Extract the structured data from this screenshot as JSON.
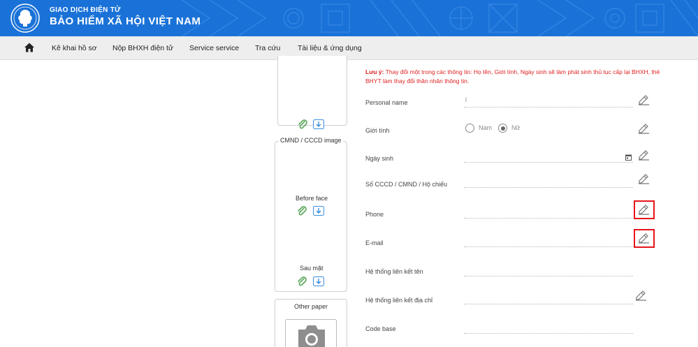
{
  "header": {
    "brand_top": "GIAO DỊCH ĐIỆN TỬ",
    "brand_main": "BẢO HIỂM XÃ HỘI VIỆT NAM",
    "bg_color": "#1a72d8"
  },
  "nav": {
    "home_icon": "home-icon",
    "items": [
      "Kê khai hồ sơ",
      "Nộp BHXH điện tử",
      "Service service",
      "Tra cứu",
      "Tài liệu & ứng dụng"
    ]
  },
  "documents": {
    "id_label": "CMND / CCCD image",
    "before_label": "Before face",
    "after_label": "Sau mặt",
    "other_label": "Other paper",
    "icons": [
      "paperclip-icon",
      "download-icon",
      "camera-icon"
    ]
  },
  "form": {
    "note_prefix": "Lưu ý:",
    "note_text": " Thay đổi một trong các thông tin: Họ tên, Giới tính, Ngày sinh sẽ làm phát sinh thủ tục cấp lại BHXH, thẻ BHYT làm thay đổi thân nhân thông tin.",
    "fields": {
      "name_label": "Personal name",
      "name_value": "l",
      "gender_label": "Giới tính",
      "gender_male": "Nam",
      "gender_female": "Nữ",
      "gender_selected": "Nữ",
      "dob_label": "Ngày sinh",
      "idno_label": "Số CCCD / CMND / Hộ chiếu",
      "phone_label": "Phone",
      "email_label": "E-mail",
      "link_name_label": "Hệ thống liên kết tên",
      "link_addr_label": "Hệ thống liên kết địa chỉ",
      "code_label": "Code base"
    },
    "highlight_color": "#e8141b",
    "note_color": "#e02020"
  }
}
